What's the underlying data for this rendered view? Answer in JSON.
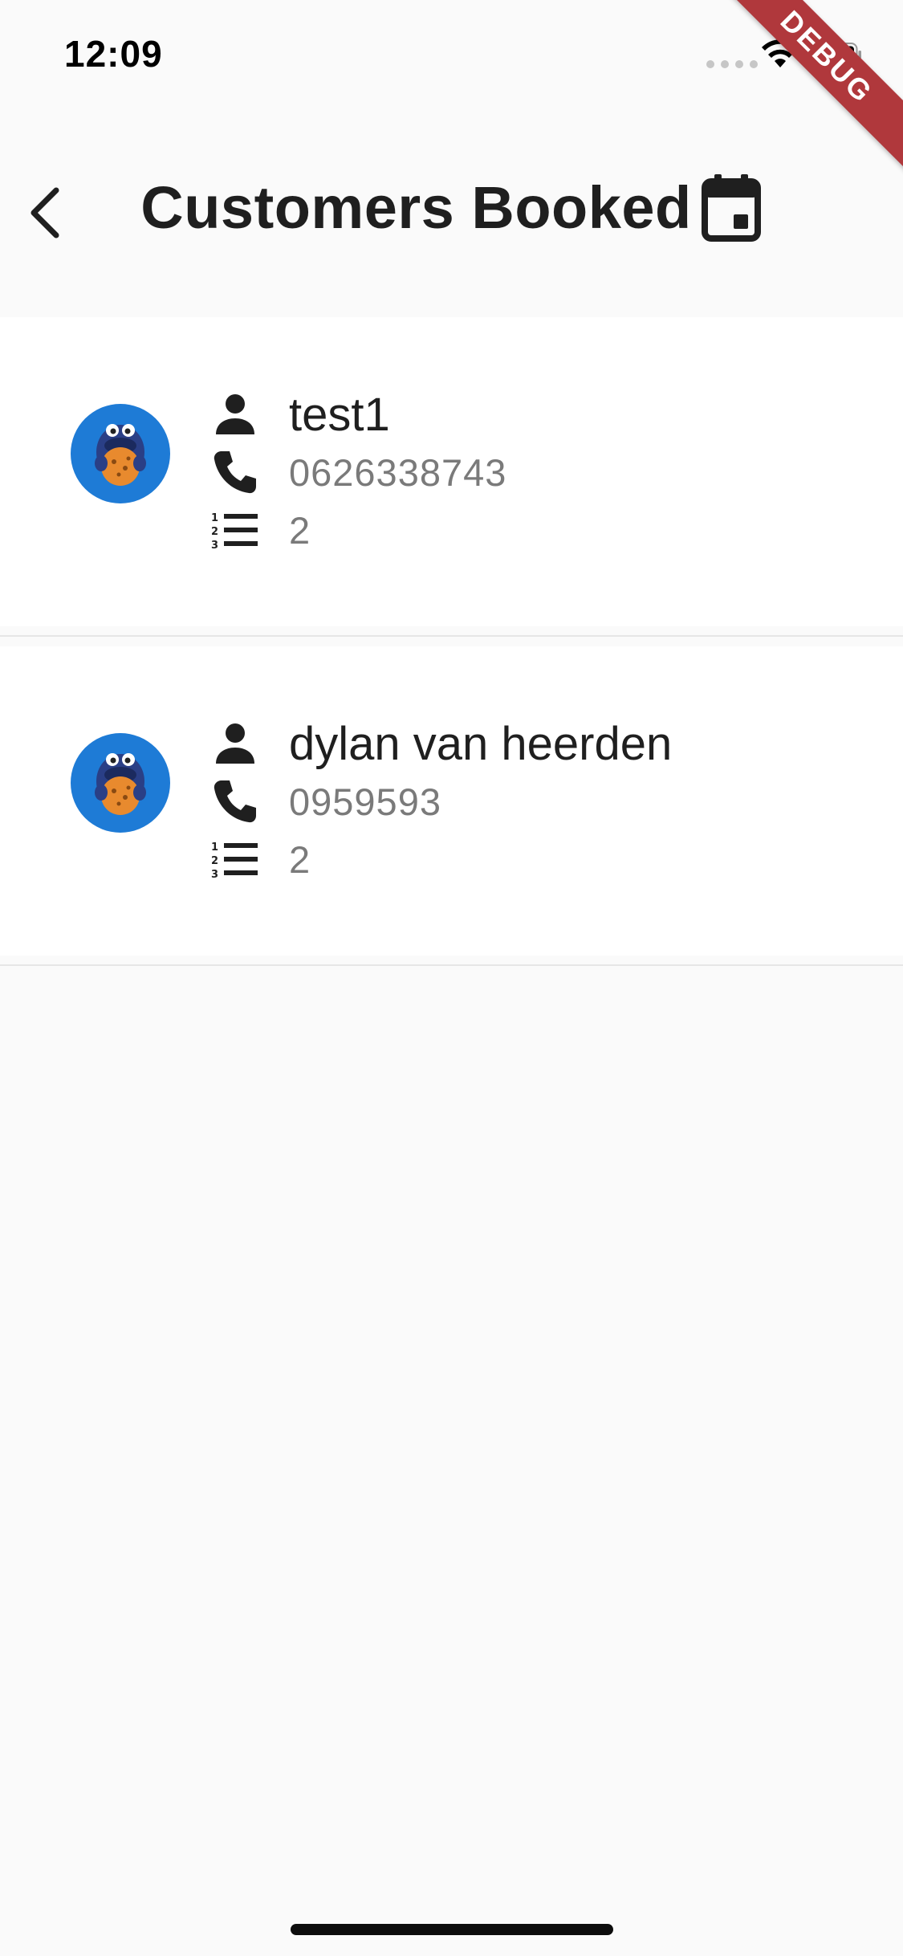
{
  "status_bar": {
    "time": "12:09",
    "debug_label": "DEBUG"
  },
  "app_bar": {
    "title": "Customers Booked",
    "back_icon": "chevron-left-icon",
    "trailing_icon": "calendar-event-icon"
  },
  "customers": [
    {
      "name": "test1",
      "phone": "0626338743",
      "count": "2"
    },
    {
      "name": "dylan van heerden",
      "phone": "0959593",
      "count": "2"
    }
  ],
  "colors": {
    "background": "#fafafa",
    "card": "#ffffff",
    "avatar_blue": "#1e7bd6",
    "debug_banner": "#b0383c",
    "secondary_text": "#7a7a7a"
  }
}
